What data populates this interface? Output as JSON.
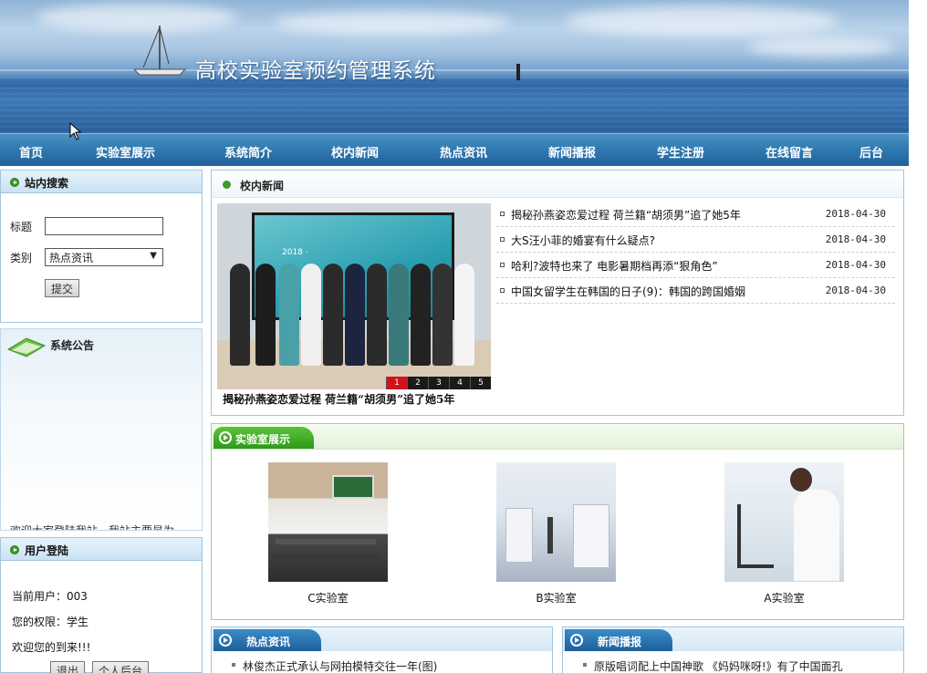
{
  "banner": {
    "title": "高校实验室预约管理系统"
  },
  "nav": {
    "items": [
      "首页",
      "实验室展示",
      "系统简介",
      "校内新闻",
      "热点资讯",
      "新闻播报",
      "学生注册",
      "在线留言",
      "后台"
    ]
  },
  "search_panel": {
    "title": "站内搜索",
    "title_label": "标题",
    "title_value": "",
    "category_label": "类别",
    "category_selected": "热点资讯",
    "submit_label": "提交"
  },
  "notice_panel": {
    "title": "系统公告",
    "scroll_text": "欢迎大家登陆我站，我站主要是为..."
  },
  "login_panel": {
    "title": "用户登陆",
    "current_user": "当前用户：003",
    "role": "您的权限：学生",
    "welcome": "欢迎您的到来!!!",
    "logout_label": "退出",
    "backend_label": "个人后台"
  },
  "news": {
    "title": "校内新闻",
    "photo_caption": "揭秘孙燕姿恋爱过程 荷兰籍“胡须男”追了她5年",
    "slide_numbers": [
      "1",
      "2",
      "3",
      "4",
      "5"
    ],
    "items": [
      {
        "text": "揭秘孙燕姿恋爱过程 荷兰籍“胡须男”追了她5年",
        "date": "2018-04-30"
      },
      {
        "text": "大S汪小菲的婚宴有什么疑点?",
        "date": "2018-04-30"
      },
      {
        "text": "哈利?波特也来了 电影暑期档再添“狠角色”",
        "date": "2018-04-30"
      },
      {
        "text": "中国女留学生在韩国的日子(9)：韩国的跨国婚姻",
        "date": "2018-04-30"
      }
    ]
  },
  "labs": {
    "title": "实验室展示",
    "items": [
      {
        "name": "C实验室"
      },
      {
        "name": "B实验室"
      },
      {
        "name": "A实验室"
      }
    ]
  },
  "hot_news": {
    "title": "热点资讯",
    "first_item": "林俊杰正式承认与网拍模特交往一年(图)"
  },
  "broadcast": {
    "title": "新闻播报",
    "first_item": "原版唱词配上中国神歌 《妈妈咪呀!》有了中国面孔"
  },
  "colors": {
    "nav_bg": "#2f78b0",
    "panel_border": "#9fc6e2",
    "green_accent": "#2c9a1a",
    "slide_active": "#d4111b"
  }
}
